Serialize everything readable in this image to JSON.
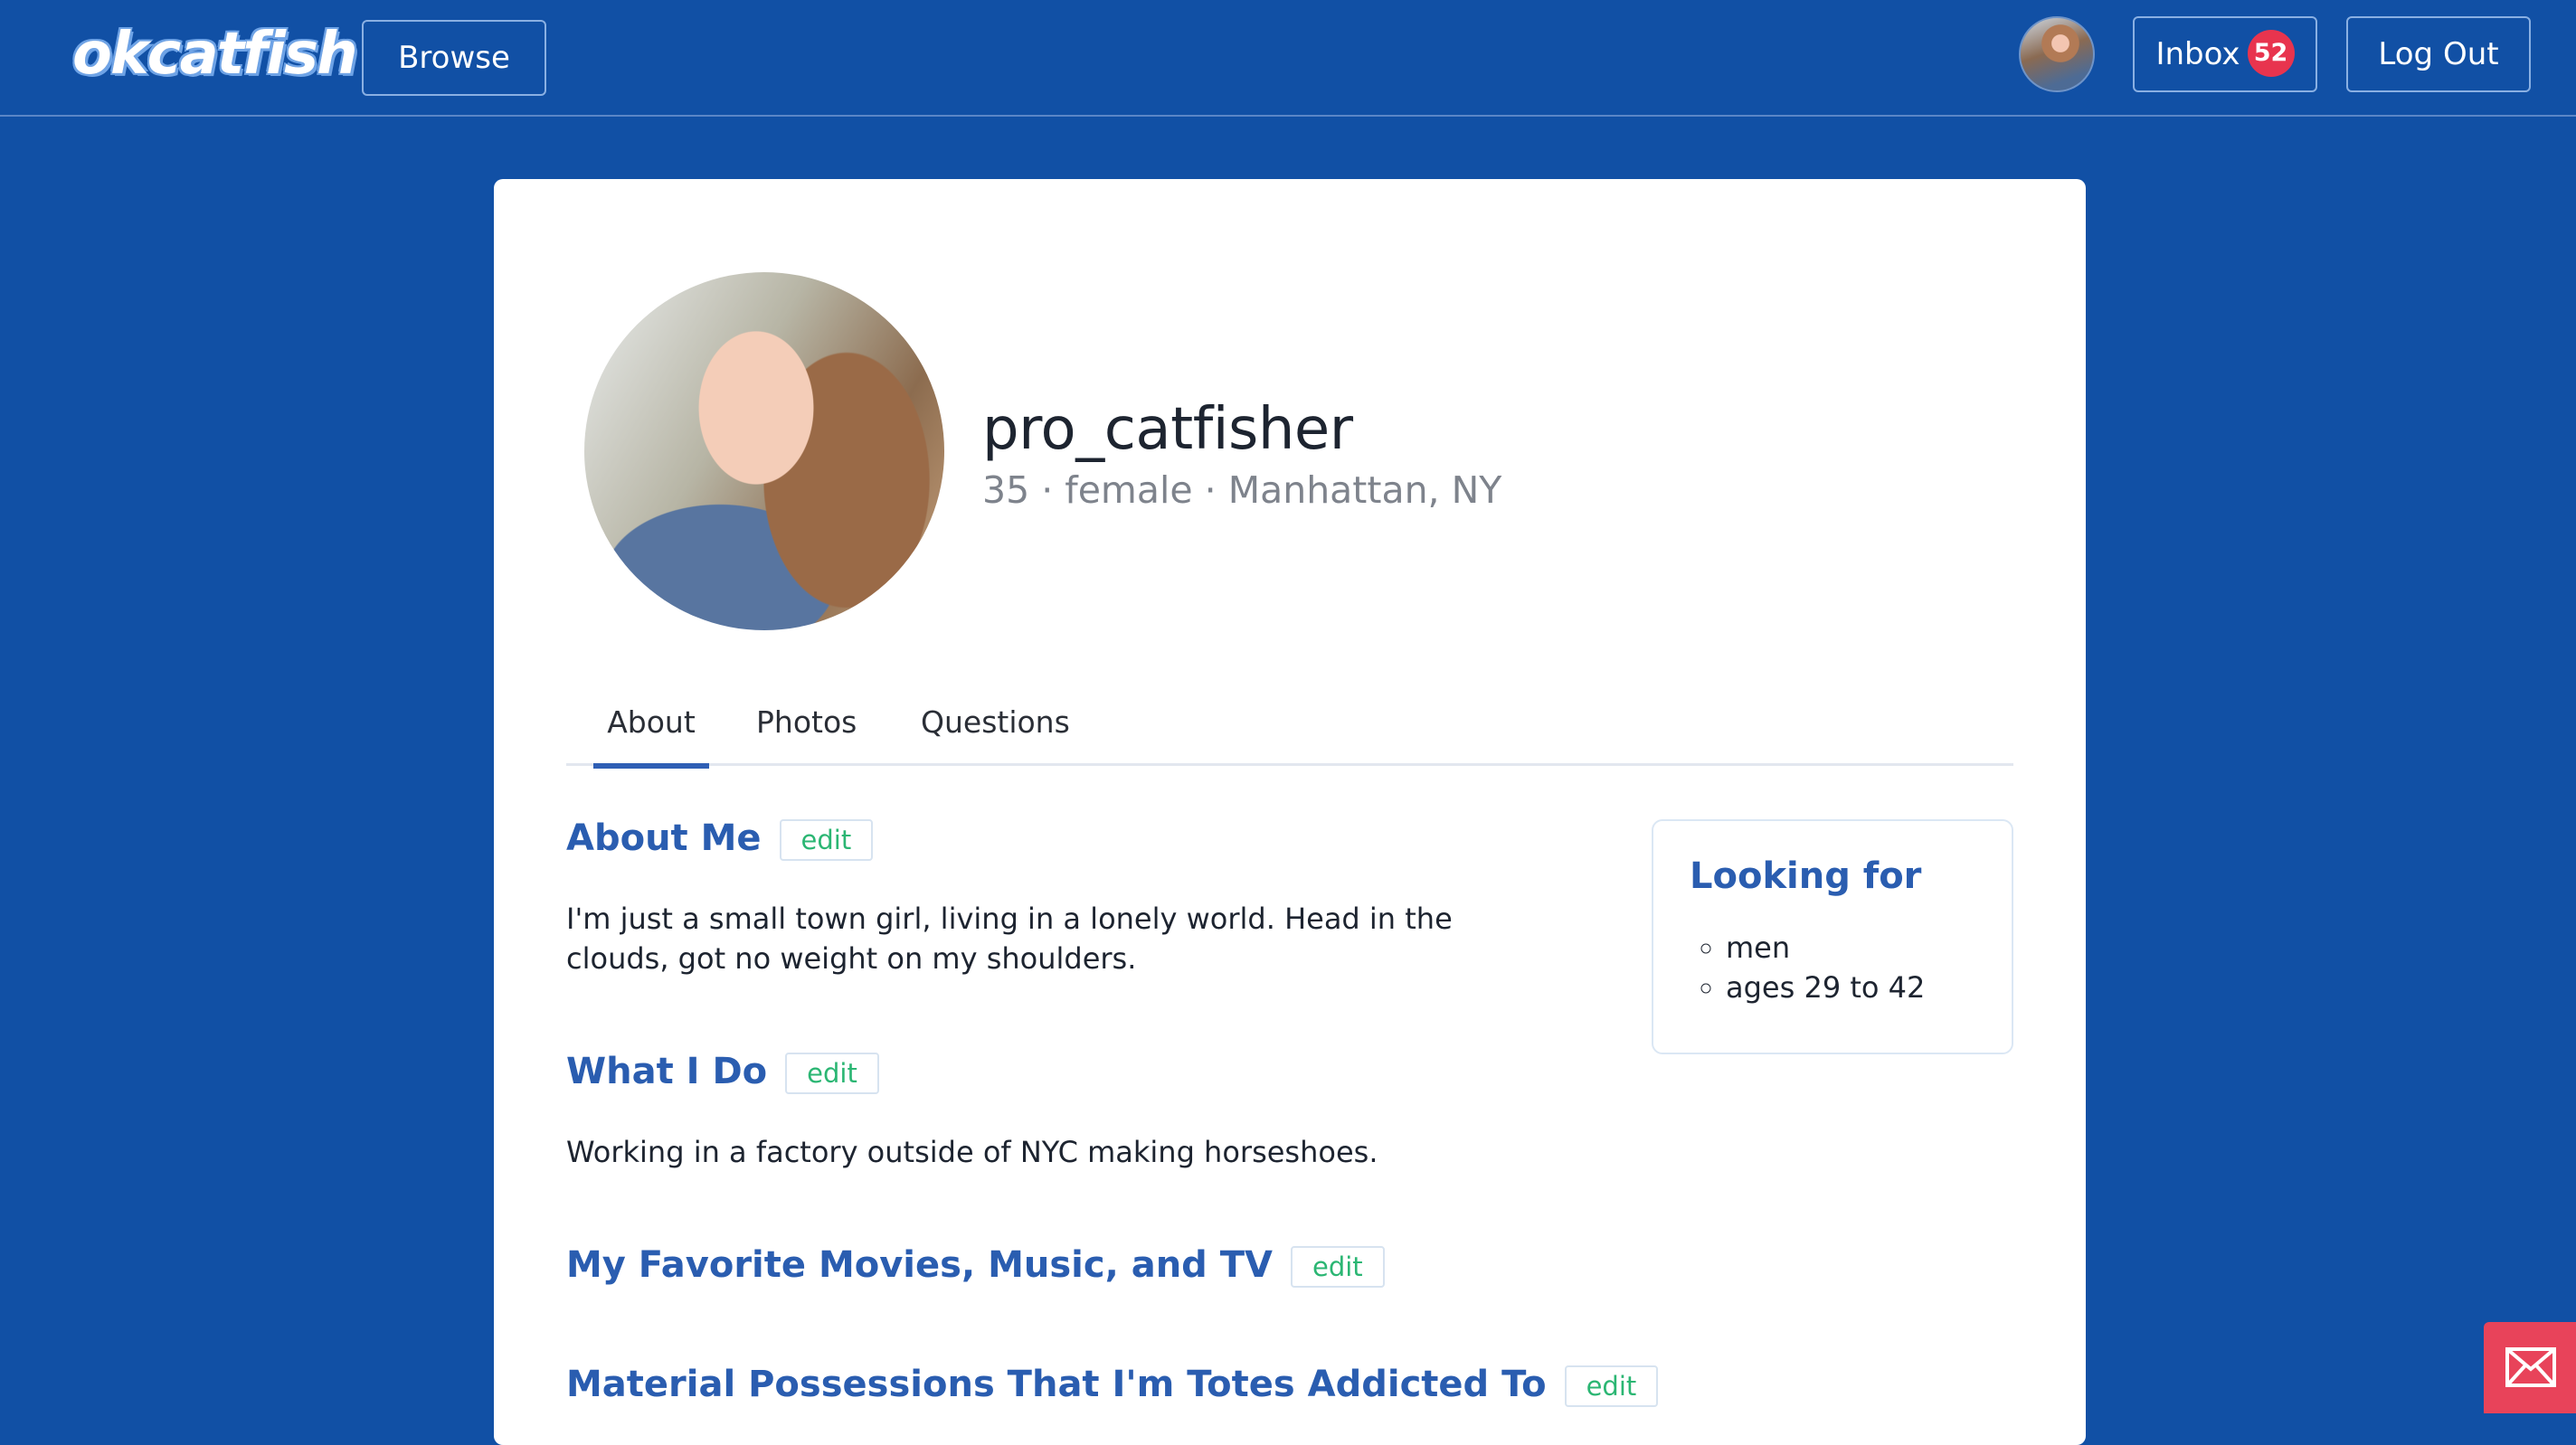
{
  "nav": {
    "logo": "okcatfish",
    "browse_label": "Browse",
    "inbox_label": "Inbox",
    "inbox_count": "52",
    "logout_label": "Log Out"
  },
  "profile": {
    "username": "pro_catfisher",
    "meta": "35 · female · Manhattan, NY"
  },
  "tabs": [
    "About",
    "Photos",
    "Questions"
  ],
  "sections": [
    {
      "title": "About Me",
      "edit": "edit",
      "text": "I'm just a small town girl, living in a lonely world. Head in the clouds, got no weight on my shoulders."
    },
    {
      "title": "What I Do",
      "edit": "edit",
      "text": "Working in a factory outside of NYC making horseshoes."
    },
    {
      "title": "My Favorite Movies, Music, and TV",
      "edit": "edit"
    },
    {
      "title": "Material Possessions That I'm Totes Addicted To",
      "edit": "edit"
    }
  ],
  "looking_for": {
    "title": "Looking for",
    "items": [
      "men",
      "ages 29 to 42"
    ]
  },
  "colors": {
    "background": "#1150a5",
    "accent": "#2a5db0",
    "edit": "#2bb673",
    "badge": "#e8344e",
    "fab": "#e8435a"
  },
  "icons": {
    "mail_fab": "envelope-icon"
  }
}
